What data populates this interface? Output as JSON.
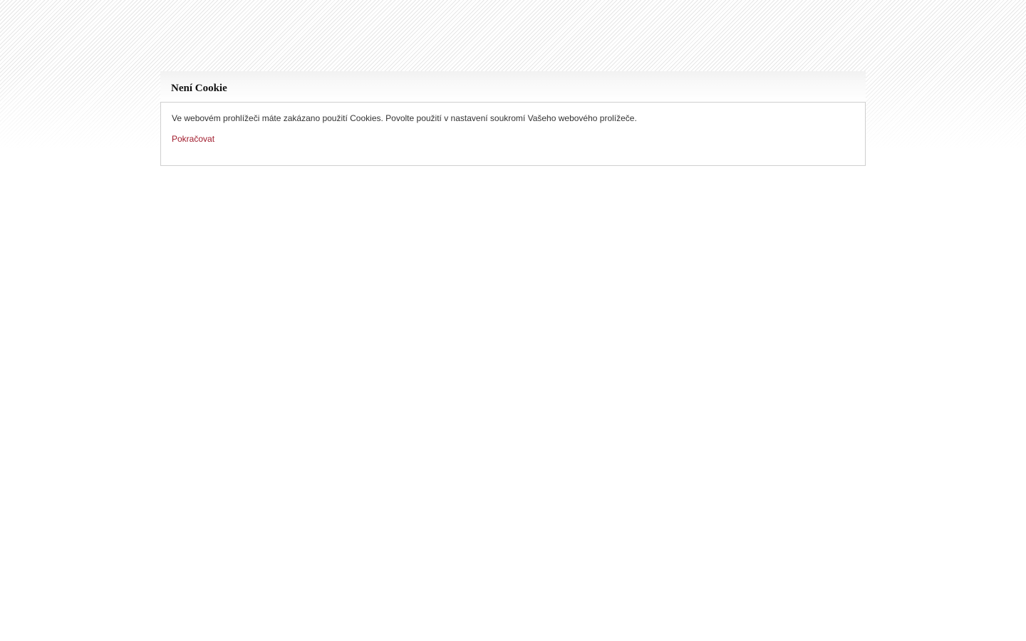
{
  "dialog": {
    "title": "Není Cookie",
    "message": "Ve webovém prohlížeči máte zakázano použití Cookies. Povolte použití v nastavení soukromí Vašeho webového prolížeče.",
    "continue_label": "Pokračovat"
  },
  "colors": {
    "link": "#a01b2c",
    "text": "#333333",
    "border": "#cfcfcf"
  }
}
